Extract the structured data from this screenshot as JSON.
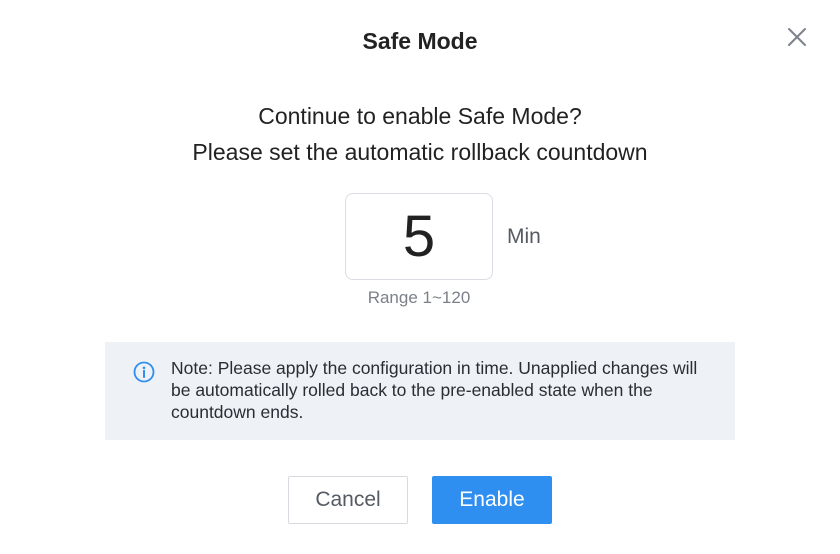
{
  "dialog": {
    "title": "Safe Mode",
    "close_icon": "close-icon",
    "question_line1": "Continue to enable Safe Mode?",
    "question_line2": "Please set the automatic rollback countdown",
    "countdown": {
      "value": "5",
      "unit": "Min",
      "range_hint": "Range 1~120"
    },
    "note": {
      "icon": "info-icon",
      "text": "Note: Please apply the configuration in time. Unapplied changes will be automatically rolled back to the pre-enabled state when the countdown ends."
    },
    "buttons": {
      "cancel_label": "Cancel",
      "enable_label": "Enable"
    },
    "colors": {
      "primary": "#2e8ff0",
      "note_background": "#eef1f6"
    }
  }
}
